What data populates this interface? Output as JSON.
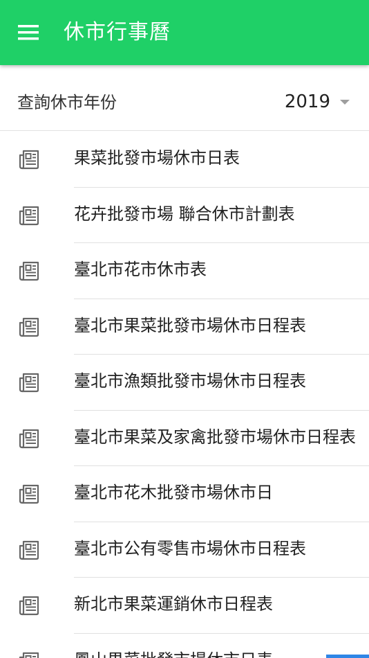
{
  "header": {
    "title": "休市行事曆",
    "background_color": "#1fd067"
  },
  "year_selector": {
    "label": "查詢休市年份",
    "selected_year": "2019"
  },
  "list": {
    "icon": "newspaper-icon",
    "items": [
      {
        "label": "果菜批發市場休市日表"
      },
      {
        "label": "花卉批發市場 聯合休市計劃表"
      },
      {
        "label": "臺北市花市休市表"
      },
      {
        "label": "臺北市果菜批發市場休市日程表"
      },
      {
        "label": "臺北市漁類批發市場休市日程表"
      },
      {
        "label": "臺北市果菜及家禽批發市場休市日程表"
      },
      {
        "label": "臺北市花木批發市場休市日"
      },
      {
        "label": "臺北市公有零售市場休市日程表"
      },
      {
        "label": "新北市果菜運銷休市日程表"
      },
      {
        "label": "鳳山果菜批發市場休市日表"
      }
    ]
  }
}
